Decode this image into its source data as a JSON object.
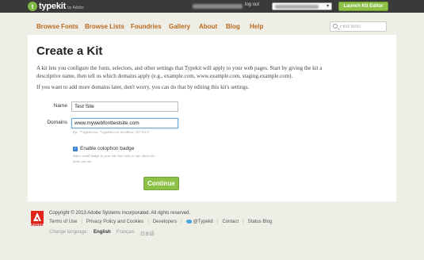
{
  "topbar": {
    "logo_mark": "t",
    "logo_text": "typekit",
    "logo_by": "by Adobe",
    "logout": "log out",
    "launch_button": "Launch Kit Editor",
    "select_arrow": "▾"
  },
  "nav": {
    "items": [
      "Browse Fonts",
      "Browse Lists",
      "Foundries",
      "Gallery",
      "About",
      "Blog",
      "Help"
    ],
    "search_placeholder": "Find fonts"
  },
  "main": {
    "title": "Create a Kit",
    "paragraph1": "A kit lets you configure the fonts, selectors, and other settings that Typekit will apply to your web pages. Start by giving the kit a descriptive name, then tell us which domains apply (e.g., example.com, www.example.com, staging.example.com).",
    "paragraph2": "If you want to add more domains later, don't worry, you can do that by editing this kit's settings.",
    "name_label": "Name",
    "name_value": "Test Site",
    "domains_label": "Domains",
    "domains_value": "www.mywebfonttestsite.com",
    "domains_hint": "Eg: \"*.typekit.net, *.typekit.com, localhost, 127.0.0.1\"",
    "checkbox_checked": true,
    "checkbox_glyph": "✓",
    "checkbox_label": "Enable colophon badge",
    "checkbox_desc": "Add a small badge to your site that links to info about the fonts you use.",
    "continue_button": "Continue"
  },
  "footer": {
    "adobe_text": "Adobe",
    "copyright": "Copyright © 2013 Adobe Systems Incorporated. All rights reserved.",
    "links": [
      "Terms of Use",
      "Privacy Policy and Cookies",
      "Developers",
      "@Typekit",
      "Contact",
      "Status Blog"
    ],
    "change_language": "Change language:",
    "languages": [
      "English",
      "Français",
      "日本語"
    ],
    "active_language": "English"
  },
  "colors": {
    "accent_green": "#8cc046",
    "nav_link": "#b9691f",
    "topbar": "#3a3a3a",
    "background": "#efeee6"
  }
}
